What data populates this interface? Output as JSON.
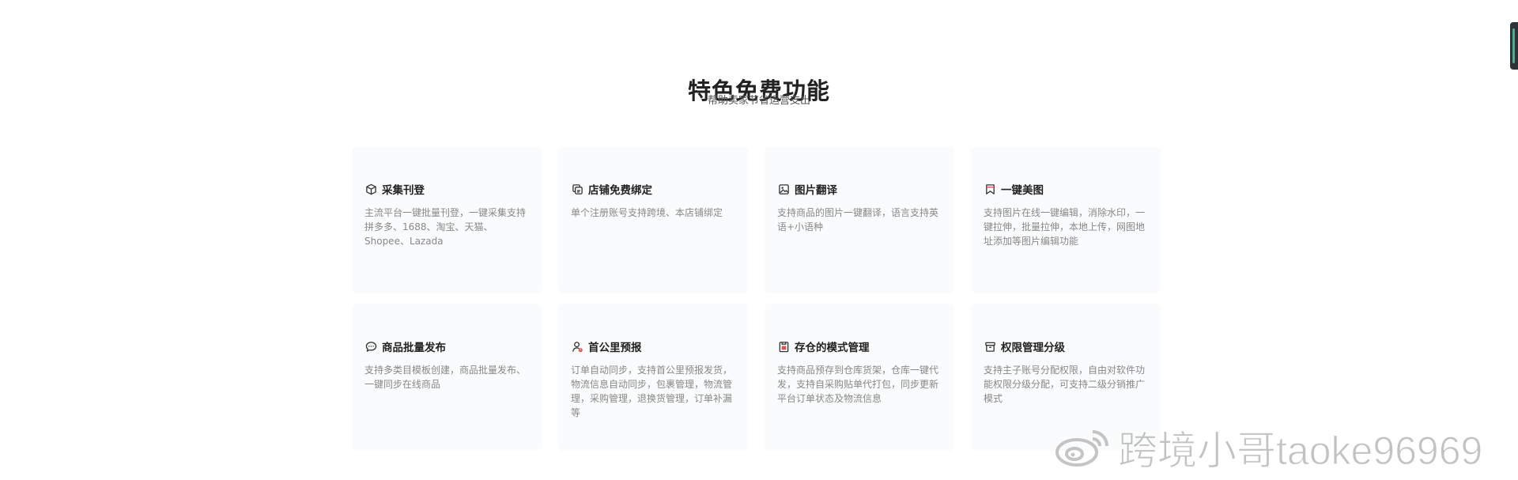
{
  "header": {
    "title": "特色免费功能",
    "subtitle": "帮助卖家节省运营支出"
  },
  "features": [
    {
      "icon": "cube-icon",
      "title": "采集刊登",
      "desc": "主流平台一键批量刊登，一键采集支持拼多多、1688、淘宝、天猫、Shopee、Lazada"
    },
    {
      "icon": "store-link-icon",
      "title": "店铺免费绑定",
      "desc": "单个注册账号支持跨境、本店铺绑定"
    },
    {
      "icon": "image-icon",
      "title": "图片翻译",
      "desc": "支持商品的图片一键翻译，语言支持英语+小语种"
    },
    {
      "icon": "bookmark-icon",
      "title": "一键美图",
      "desc": "支持图片在线一键编辑，消除水印，一键拉伸，批量拉伸，本地上传，网图地址添加等图片编辑功能"
    },
    {
      "icon": "chat-bubble-icon",
      "title": "商品批量发布",
      "desc": "支持多类目模板创建，商品批量发布、一键同步在线商品"
    },
    {
      "icon": "user-alert-icon",
      "title": "首公里预报",
      "desc": "订单自动同步，支持首公里预报发货，物流信息自动同步，包裹管理，物流管理，采购管理，退换货管理，订单补漏等"
    },
    {
      "icon": "warehouse-icon",
      "title": "存仓的模式管理",
      "desc": "支持商品预存到仓库货架，仓库一键代发，支持自采购贴单代打包，同步更新平台订单状态及物流信息"
    },
    {
      "icon": "archive-box-icon",
      "title": "权限管理分级",
      "desc": "支持主子账号分配权限，自由对软件功能权限分级分配，可支持二级分销推广模式"
    }
  ],
  "watermark": {
    "text": "跨境小哥taoke96969",
    "icon": "weibo-logo-icon"
  }
}
